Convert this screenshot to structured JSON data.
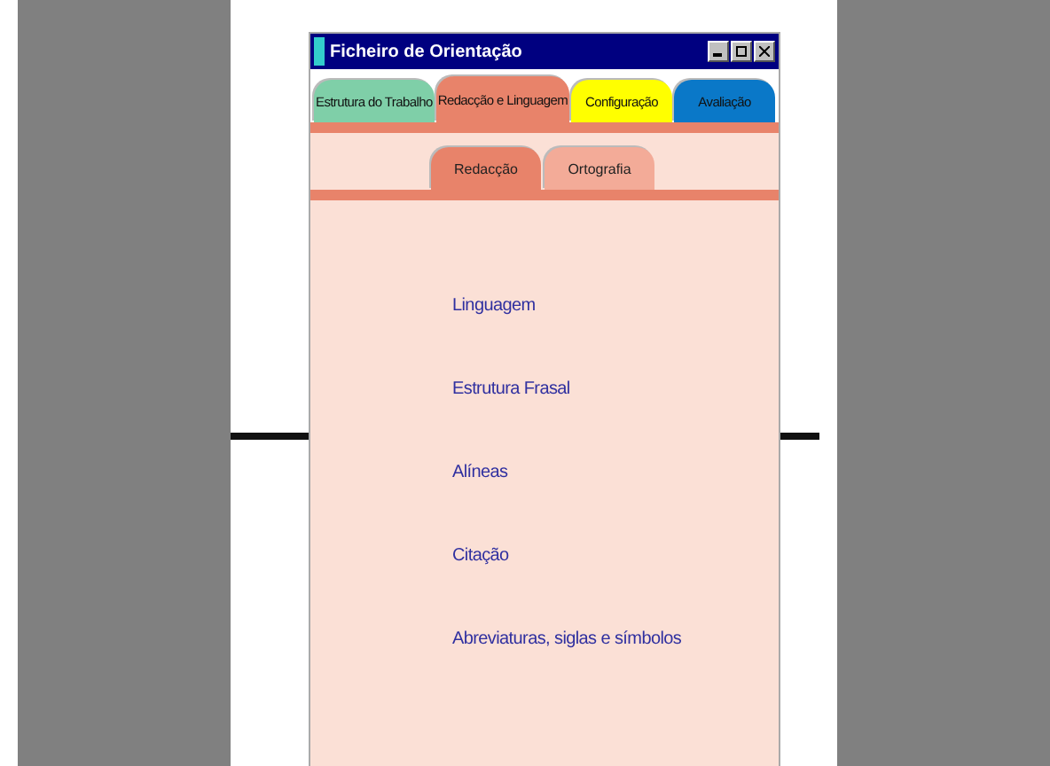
{
  "window": {
    "title": "Ficheiro de Orientação"
  },
  "tabs": [
    {
      "label": "Estrutura do Trabalho",
      "selected": false,
      "color": "#7fcfa8"
    },
    {
      "label": "Redacção e Linguagem",
      "selected": true,
      "color": "#e8836a"
    },
    {
      "label": "Configuração",
      "selected": false,
      "color": "#ffff00"
    },
    {
      "label": "Avaliação",
      "selected": false,
      "color": "#0a78c8"
    }
  ],
  "subtabs": [
    {
      "label": "Redacção",
      "selected": true
    },
    {
      "label": "Ortografia",
      "selected": false
    }
  ],
  "links": [
    "Linguagem",
    "Estrutura Frasal",
    "Alíneas",
    "Citação",
    "Abreviaturas, siglas e símbolos"
  ]
}
